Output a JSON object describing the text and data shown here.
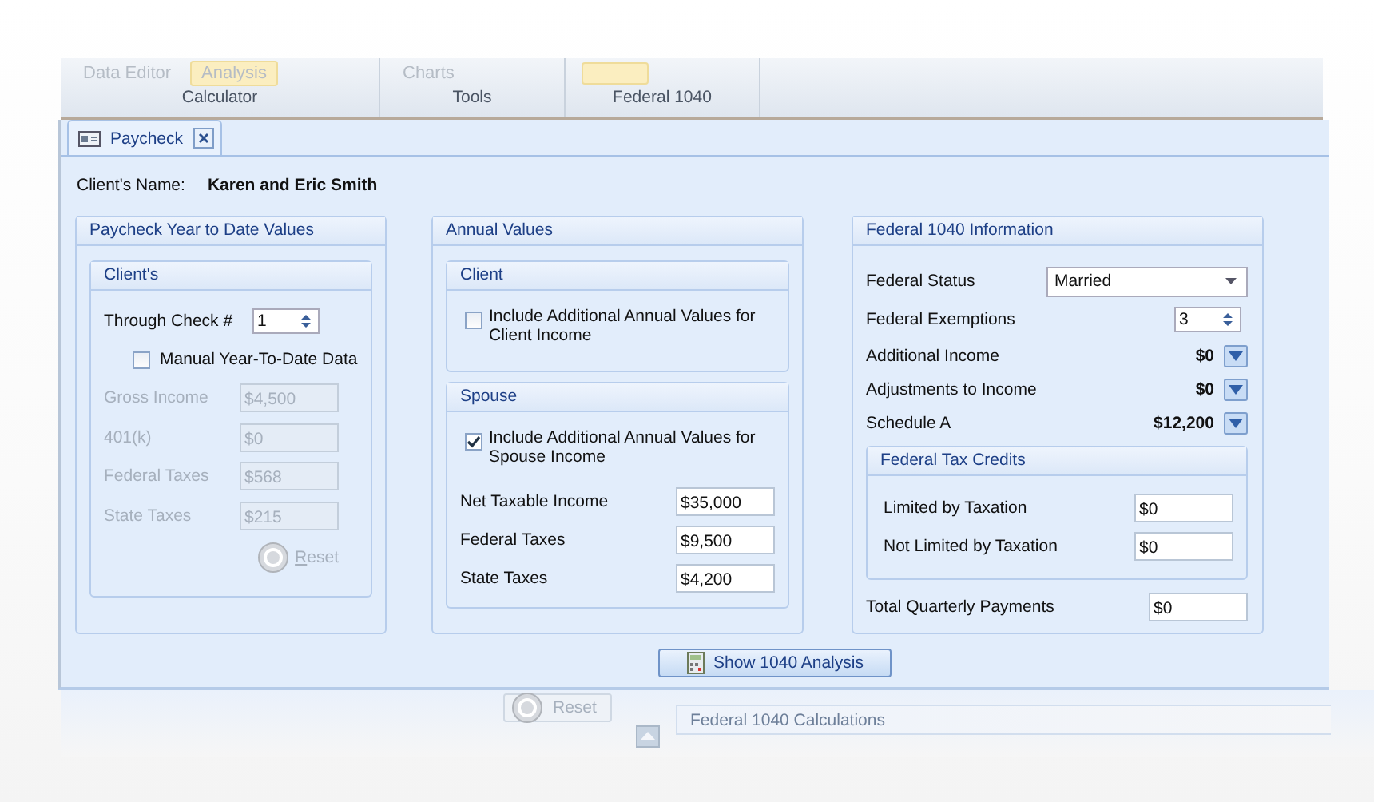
{
  "ribbon": {
    "groups": [
      {
        "label": "Calculator",
        "items": [
          {
            "label": "Data Editor",
            "selected": false
          },
          {
            "label": "Analysis",
            "selected": true
          }
        ]
      },
      {
        "label": "Tools",
        "items": [
          {
            "label": "Charts",
            "selected": false
          }
        ]
      },
      {
        "label": "Federal 1040",
        "blank_button_active": true
      }
    ]
  },
  "tabs": [
    {
      "label": "Paycheck",
      "selected": true,
      "closable": true
    }
  ],
  "client_name": {
    "label": "Client's Name:",
    "value": "Karen and Eric Smith"
  },
  "ytd_panel": {
    "title": "Paycheck Year to Date Values",
    "group": {
      "title": "Client's",
      "through_check": {
        "label": "Through Check #",
        "value": "1"
      },
      "manual": {
        "label": "Manual Year-To-Date Data",
        "checked": false
      },
      "fields": [
        {
          "label": "Gross Income",
          "value": "$4,500",
          "disabled": true
        },
        {
          "label": "401(k)",
          "value": "$0",
          "disabled": true
        },
        {
          "label": "Federal Taxes",
          "value": "$568",
          "disabled": true
        },
        {
          "label": "State Taxes",
          "value": "$215",
          "disabled": true
        }
      ],
      "reset": {
        "label": "Reset",
        "disabled": true
      }
    }
  },
  "annual_panel": {
    "title": "Annual Values",
    "groups": [
      {
        "title": "Client",
        "include": {
          "label": "Include Additional Annual Values for Client Income",
          "checked": false
        }
      },
      {
        "title": "Spouse",
        "include": {
          "label": "Include Additional Annual Values for Spouse Income",
          "checked": true
        },
        "fields": [
          {
            "label": "Net Taxable Income",
            "value": "$35,000"
          },
          {
            "label": "Federal Taxes",
            "value": "$9,500"
          },
          {
            "label": "State Taxes",
            "value": "$4,200"
          }
        ]
      }
    ]
  },
  "federal_panel": {
    "title": "Federal 1040 Information",
    "status": {
      "label": "Federal Status",
      "value": "Married"
    },
    "exemptions": {
      "label": "Federal Exemptions",
      "value": "3"
    },
    "amounts": [
      {
        "label": "Additional Income",
        "value": "$0"
      },
      {
        "label": "Adjustments to Income",
        "value": "$0"
      },
      {
        "label": "Schedule A",
        "value": "$12,200"
      }
    ],
    "credits": {
      "title": "Federal Tax Credits",
      "fields": [
        {
          "label": "Limited by Taxation",
          "value": "$0"
        },
        {
          "label": "Not Limited by Taxation",
          "value": "$0"
        }
      ]
    },
    "quarterly": {
      "label": "Total Quarterly Payments",
      "value": "$0"
    }
  },
  "analysis_button": {
    "label": "Show 1040 Analysis"
  },
  "bottom": {
    "reset": {
      "label": "Reset",
      "disabled": true
    },
    "calculations_title": "Federal 1040 Calculations"
  }
}
